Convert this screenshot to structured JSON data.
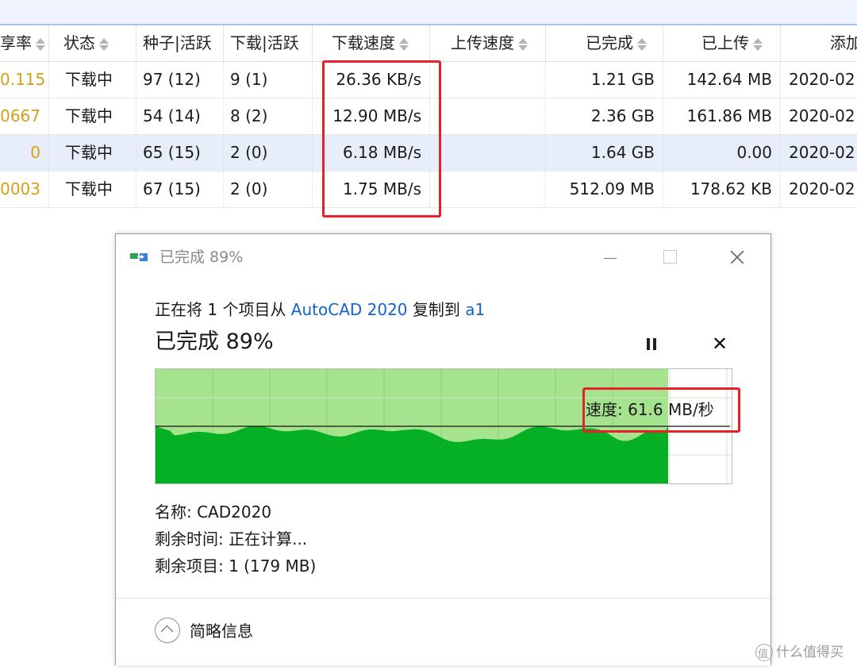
{
  "table": {
    "columns": [
      "享率",
      "状态",
      "种子|活跃",
      "下载|活跃",
      "下载速度",
      "上传速度",
      "已完成",
      "已上传",
      "添加"
    ],
    "rows": [
      {
        "ratio": "0.115",
        "status": "下载中",
        "seeds": "97 (12)",
        "peers": "9 (1)",
        "down_speed": "26.36 KB/s",
        "up_speed": "",
        "done": "1.21 GB",
        "uploaded": "142.64 MB",
        "added": "2020-02"
      },
      {
        "ratio": "0667",
        "status": "下载中",
        "seeds": "54 (14)",
        "peers": "8 (2)",
        "down_speed": "12.90 MB/s",
        "up_speed": "",
        "done": "2.36 GB",
        "uploaded": "161.86 MB",
        "added": "2020-02"
      },
      {
        "ratio": "0",
        "status": "下载中",
        "seeds": "65 (15)",
        "peers": "2 (0)",
        "down_speed": "6.18 MB/s",
        "up_speed": "",
        "done": "1.64 GB",
        "uploaded": "0.00",
        "added": "2020-02"
      },
      {
        "ratio": "0003",
        "status": "下载中",
        "seeds": "67 (15)",
        "peers": "2 (0)",
        "down_speed": "1.75 MB/s",
        "up_speed": "",
        "done": "512.09 MB",
        "uploaded": "178.62 KB",
        "added": "2020-02"
      }
    ],
    "selected_row": 2,
    "ratio_color": "#d4a017"
  },
  "dialog": {
    "title": "已完成 89%",
    "copy_prefix": "正在将 1 个项目从 ",
    "source": "AutoCAD 2020",
    "copy_mid": " 复制到 ",
    "destination": "a1",
    "progress_text": "已完成 89%",
    "progress": 0.89,
    "speed_text": "速度: 61.6 MB/秒",
    "name_line": "名称: CAD2020",
    "time_line": "剩余时间: 正在计算...",
    "items_line": "剩余项目: 1 (179 MB)",
    "details_label": "简略信息",
    "graph_fill_color": "#06b025",
    "graph_area_color": "#a6e38e",
    "link_color": "#1464c8"
  },
  "watermark": {
    "text": "什么值得买"
  },
  "highlight_color": "#e8202a"
}
